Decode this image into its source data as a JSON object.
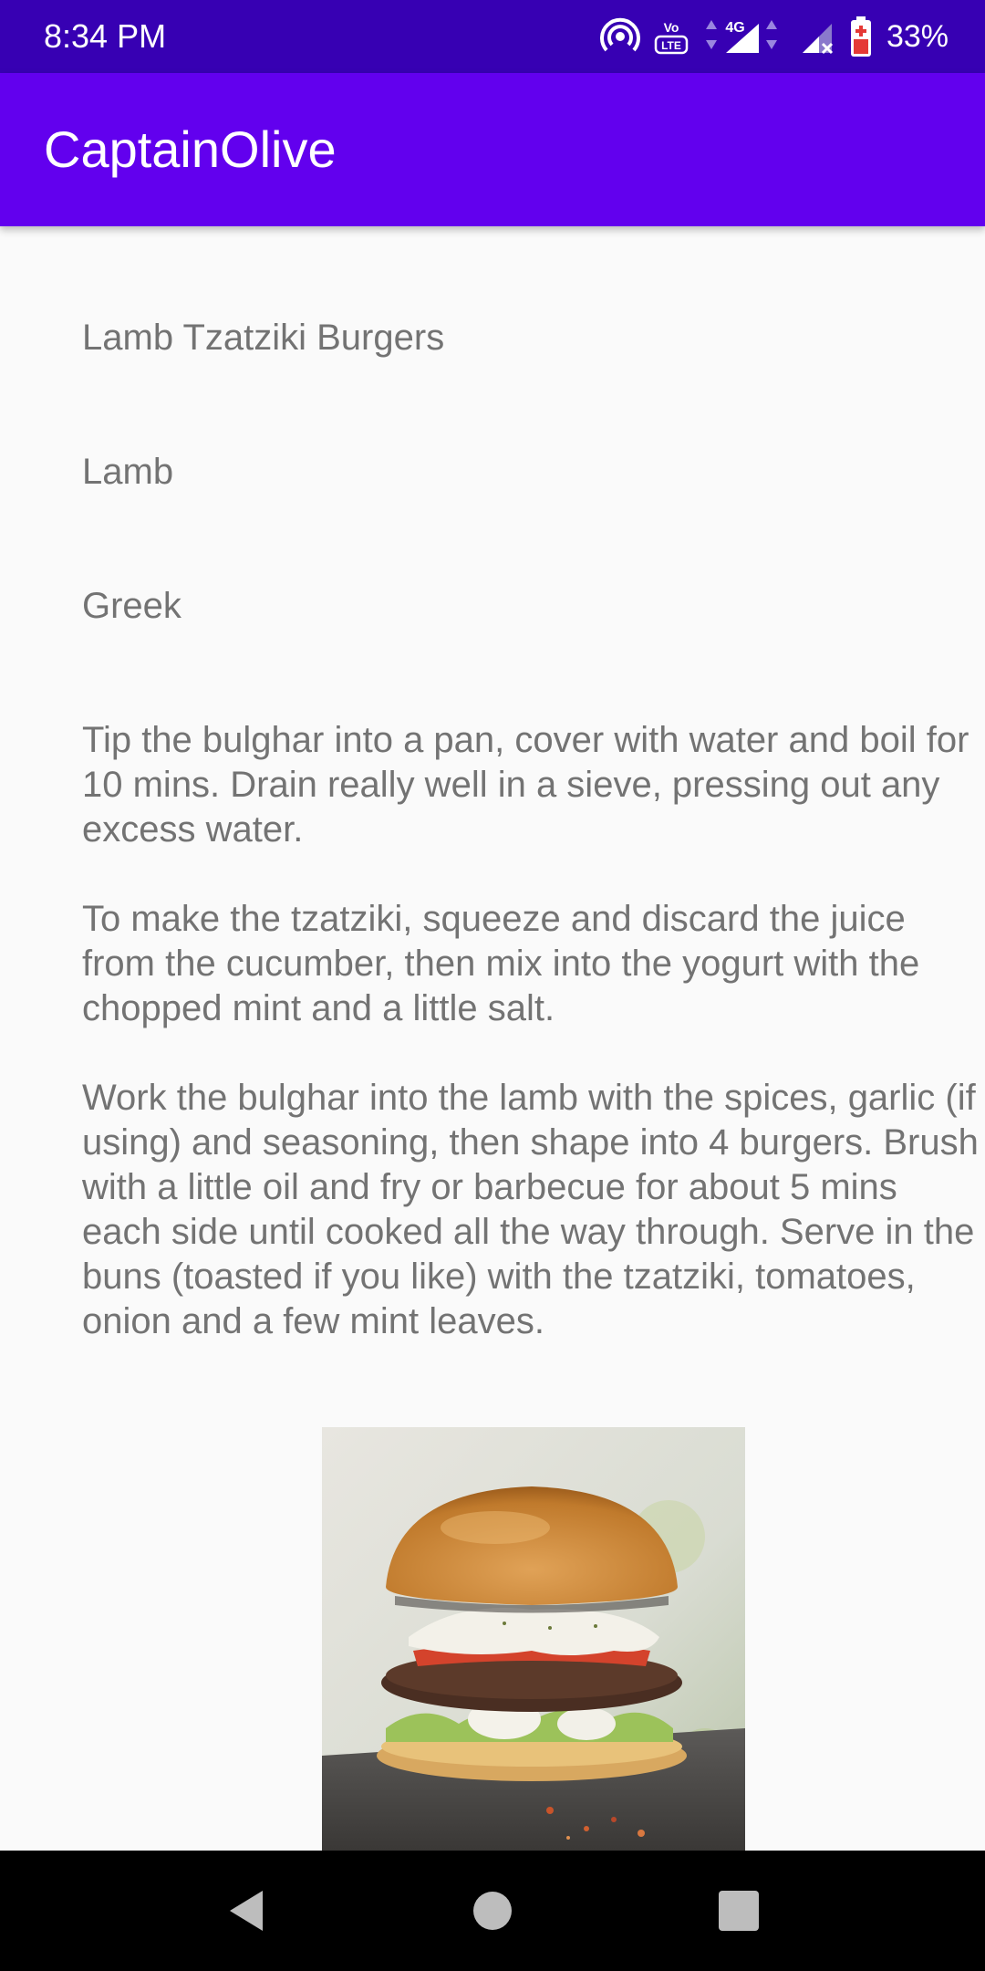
{
  "status_bar": {
    "time": "8:34 PM",
    "battery_percent": "33%",
    "icons": [
      "hotspot-icon",
      "volte-icon",
      "4g-signal-icon",
      "signal-icon",
      "battery-icon"
    ],
    "network_label": "4G",
    "volte_label": "Vo LTE"
  },
  "app_bar": {
    "title": "CaptainOlive"
  },
  "recipe": {
    "name": "Lamb Tzatziki Burgers",
    "category": "Lamb",
    "area": "Greek",
    "instructions": "Tip the bulghar into a pan, cover with water and boil for 10 mins. Drain really well in a sieve, pressing out any excess water.\n\nTo make the tzatziki, squeeze and discard the juice from the cucumber, then mix into the yogurt with the chopped mint and a little salt.\n\nWork the bulghar into the lamb with the spices, garlic (if using) and seasoning, then shape into 4 burgers. Brush with a little oil and fry or barbecue for about 5 mins each side until cooked all the way through. Serve in the buns (toasted if you like) with the tzatziki, tomatoes, onion and a few mint leaves."
  },
  "nav_bar": {
    "icons": [
      "back-icon",
      "home-icon",
      "recents-icon"
    ]
  },
  "colors": {
    "status_bar": "#3700b3",
    "app_bar": "#6200ee",
    "background": "#fafafa",
    "text": "#737373"
  }
}
